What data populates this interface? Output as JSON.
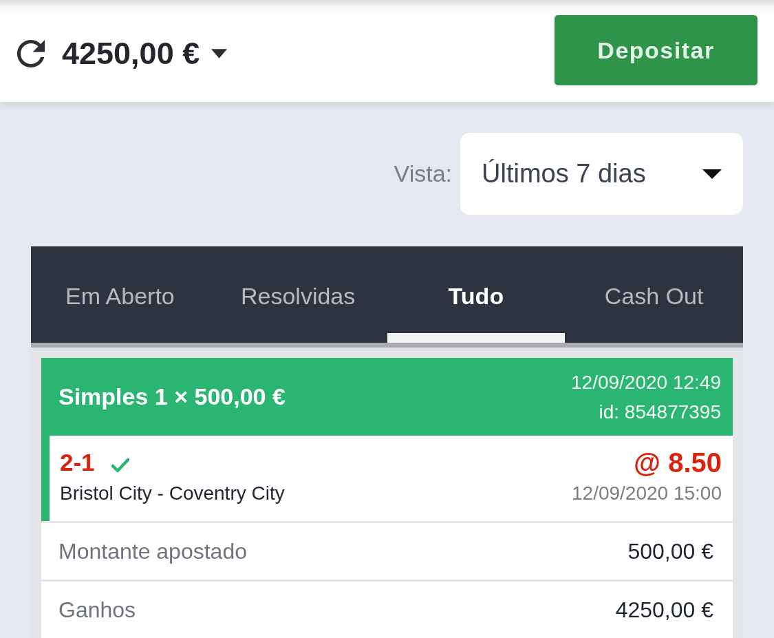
{
  "header": {
    "balance": "4250,00 €",
    "deposit_button": "Depositar"
  },
  "view_filter": {
    "label": "Vista:",
    "value": "Últimos 7 dias"
  },
  "tabs": [
    {
      "label": "Em Aberto",
      "selected": false
    },
    {
      "label": "Resolvidas",
      "selected": false
    },
    {
      "label": "Tudo",
      "selected": true
    },
    {
      "label": "Cash Out",
      "selected": false
    }
  ],
  "bet": {
    "title": "Simples 1 × 500,00 €",
    "placed": "12/09/2020 12:49",
    "id": "id: 854877395",
    "selection": {
      "score": "2-1",
      "won": true,
      "match": "Bristol City - Coventry City",
      "odds": "@ 8.50",
      "kickoff": "12/09/2020 15:00"
    },
    "details": [
      {
        "label": "Montante apostado",
        "value": "500,00 €"
      },
      {
        "label": "Ganhos",
        "value": "4250,00 €"
      }
    ]
  }
}
